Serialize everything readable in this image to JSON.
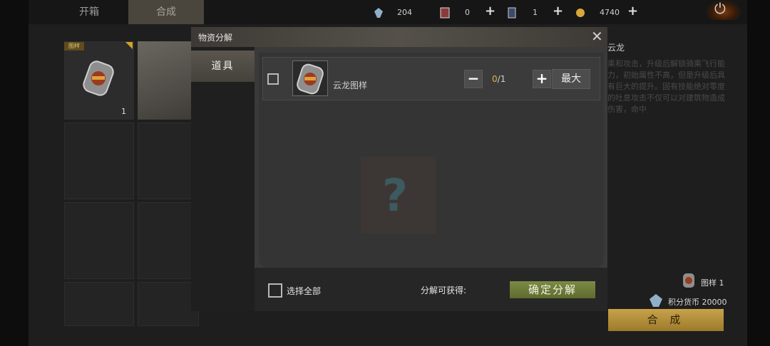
{
  "tabs": {
    "kaixiang": "开箱",
    "hecheng": "合成"
  },
  "resources": [
    {
      "icon": "crystal-icon",
      "value": "204"
    },
    {
      "icon": "card-icon",
      "value": "0"
    },
    {
      "icon": "phone-card-icon",
      "value": "1"
    },
    {
      "icon": "gold-coin-icon",
      "value": "4740"
    }
  ],
  "inventory": {
    "selected_tag": "图样",
    "selected_count": "1"
  },
  "detail": {
    "title": "云龙",
    "description": "乘和攻击，升级后解锁骑乘飞行能力，初始属性不高，但是升级后具有巨大的提升。固有技能绝对零度的吐息攻击不仅可以对建筑物造成伤害，命中",
    "cost_item": "图样 1",
    "cost_currency": "积分货币 20000",
    "craft_label": "合 成"
  },
  "modal": {
    "title": "物资分解",
    "side_tab": "道具",
    "item": {
      "name": "云龙图样",
      "current": "0",
      "max": "/1"
    },
    "max_label": "最大",
    "select_all_label": "选择全部",
    "yield_label": "分解可获得:",
    "confirm_label": "确定分解"
  },
  "colors": {
    "accent_gold": "#e3b53c",
    "confirm_green": "#6d7a3a",
    "craft_gold": "#b89439"
  }
}
